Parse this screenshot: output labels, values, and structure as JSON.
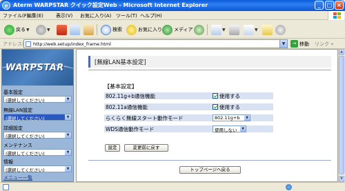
{
  "window": {
    "title": "Aterm WARPSTAR クイック設定Web - Microsoft Internet Explorer"
  },
  "menu": [
    "ファイル(F)",
    "編集(E)",
    "表示(V)",
    "お気に入り(A)",
    "ツール(T)",
    "ヘルプ(H)"
  ],
  "toolbar": {
    "back": "戻る",
    "search": "検索",
    "favorites": "お気に入り",
    "media": "メディア"
  },
  "address": {
    "label": "アドレス(D)",
    "url": "http://web.setup/index_frame.html",
    "go": "移動",
    "links": "リンク"
  },
  "sidebar": {
    "logo": "WARPSTAR",
    "sections": [
      {
        "heading": "基本設定",
        "value": "(選択してください)"
      },
      {
        "heading": "無線LAN設定",
        "value": "(選択してください)"
      },
      {
        "heading": "詳細設定",
        "value": "(選択してください)"
      },
      {
        "heading": "メンテナンス",
        "value": "(選択してください)"
      },
      {
        "heading": "情報",
        "value": "(選択してください)"
      }
    ],
    "footer": "メニュー一覧"
  },
  "main": {
    "page_title": "[無線LAN基本設定]",
    "section_title": "【基本設定】",
    "rows": [
      {
        "label": "802.11g+b通信機能",
        "value": "使用する"
      },
      {
        "label": "802.11a通信機能",
        "value": "使用する"
      },
      {
        "label": "らくらく無線スタート動作モード",
        "value": "802.11g+b"
      },
      {
        "label": "WDS通信動作モード",
        "value": "使用しない"
      }
    ],
    "set_button": "設定",
    "revert_button": "変更前に戻す",
    "top_button": "トップページへ戻る"
  },
  "colors": {
    "titlebar": "#0a5cd8",
    "sidebar_bg": "#9ab6d8",
    "row_bg": "#d9e2f2",
    "accent": "#4a68b3"
  }
}
